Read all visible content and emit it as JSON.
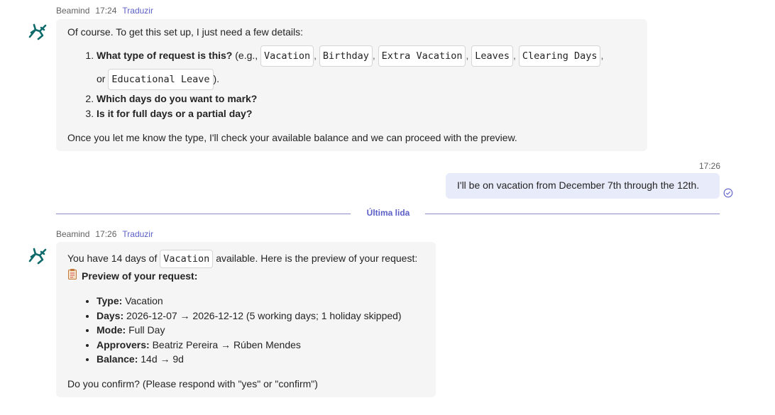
{
  "first_message": {
    "sender": "Beamind",
    "time": "17:24",
    "translate": "Traduzir",
    "intro": "Of course. To get this set up, I just need a few details:",
    "q1_bold": "What type of request is this?",
    "q1_eg": "(e.g.,",
    "types": [
      "Vacation",
      "Birthday",
      "Extra Vacation",
      "Leaves",
      "Clearing Days",
      "Educational Leave"
    ],
    "or_word": "or",
    "close_paren": ").",
    "q2": "Which days do you want to mark?",
    "q3": "Is it for full days or a partial day?",
    "outro": "Once you let me know the type, I'll check your available balance and we can proceed with the preview."
  },
  "outgoing": {
    "time": "17:26",
    "text": "I'll be on vacation from December 7th through the 12th."
  },
  "divider": {
    "label": "Última lida"
  },
  "second_message": {
    "sender": "Beamind",
    "time": "17:26",
    "translate": "Traduzir",
    "line1_pre": "You have 14 days of",
    "line1_tag": "Vacation",
    "line1_post": "available. Here is the preview of your request:",
    "preview_title": "Preview of your request:",
    "items": [
      {
        "label": "Type:",
        "value": "Vacation"
      },
      {
        "label": "Days:",
        "value": "2026-12-07 → 2026-12-12 (5 working days; 1 holiday skipped)"
      },
      {
        "label": "Mode:",
        "value": "Full Day"
      },
      {
        "label": "Approvers:",
        "value": "Beatriz Pereira → Rúben Mendes"
      },
      {
        "label": "Balance:",
        "value": "14d → 9d"
      }
    ],
    "confirm": "Do you confirm? (Please respond with \"yes\" or \"confirm\")"
  },
  "colors": {
    "accent": "#5b5fc7",
    "bot_bubble": "#f5f5f5",
    "user_bubble": "#e8ebfa",
    "bot_icon": "#0f6b6b"
  },
  "icons": {
    "bot": "bot-avatar-icon",
    "read": "read-receipt-icon",
    "clipboard": "clipboard-icon"
  }
}
